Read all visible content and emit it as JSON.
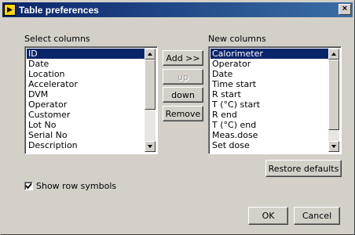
{
  "window": {
    "title": "Table preferences",
    "close_label": "×"
  },
  "select_columns": {
    "label": "Select columns",
    "items": [
      "ID",
      "Date",
      "Location",
      "Accelerator",
      "DVM",
      "Operator",
      "Customer",
      "Lot No",
      "Serial No",
      "Description"
    ],
    "selected_index": 0
  },
  "new_columns": {
    "label": "New columns",
    "items": [
      "Calorimeter",
      "Operator",
      "Date",
      "Time start",
      "R start",
      "T (°C) start",
      "R end",
      "T (°C) end",
      "Meas.dose",
      "Set dose"
    ],
    "selected_index": 0
  },
  "buttons": {
    "add": "Add >>",
    "up": "up",
    "down": "down",
    "remove": "Remove",
    "restore": "Restore defaults",
    "ok": "OK",
    "cancel": "Cancel"
  },
  "options": {
    "show_row_symbols_label": "Show row symbols",
    "show_row_symbols_checked": true
  },
  "colors": {
    "titlebar_start": "#0a246a",
    "titlebar_end": "#3a6ea5",
    "selection": "#0a246a",
    "face": "#d4d0c8"
  }
}
